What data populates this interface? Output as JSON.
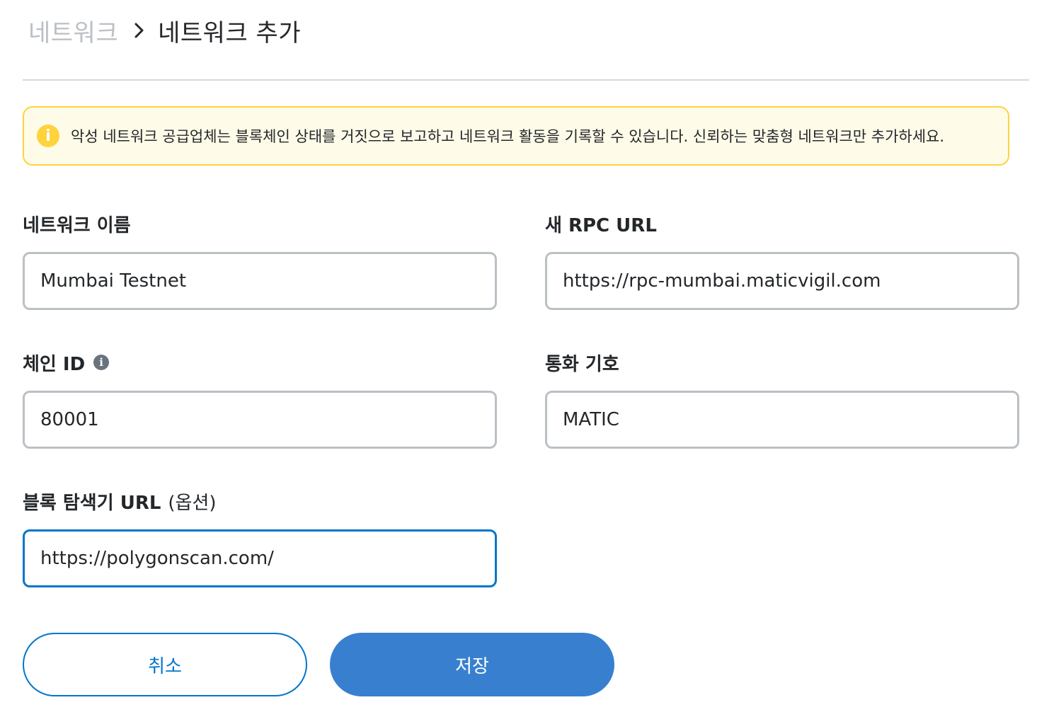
{
  "breadcrumb": {
    "parent": "네트워크",
    "current": "네트워크 추가",
    "separator_icon": "chevron-right-icon"
  },
  "warning": {
    "icon": "info-circle-icon",
    "text": "악성 네트워크 공급업체는 블록체인 상태를 거짓으로 보고하고 네트워크 활동을 기록할 수 있습니다. 신뢰하는 맞춤형 네트워크만 추가하세요.",
    "color_bg": "#fefbe8",
    "color_border": "#ffd33d"
  },
  "fields": {
    "network_name": {
      "label": "네트워크 이름",
      "value": "Mumbai Testnet"
    },
    "rpc_url": {
      "label": "새 RPC URL",
      "value": "https://rpc-mumbai.maticvigil.com"
    },
    "chain_id": {
      "label": "체인 ID",
      "value": "80001",
      "info_icon": "i"
    },
    "currency_symbol": {
      "label": "통화 기호",
      "value": "MATIC"
    },
    "block_explorer": {
      "label": "블록 탐색기 URL",
      "label_extra": "(옵션)",
      "value": "https://polygonscan.com/"
    }
  },
  "buttons": {
    "cancel": "취소",
    "save": "저장"
  },
  "colors": {
    "accent": "#0376c9",
    "primary_button": "#3880cf"
  }
}
